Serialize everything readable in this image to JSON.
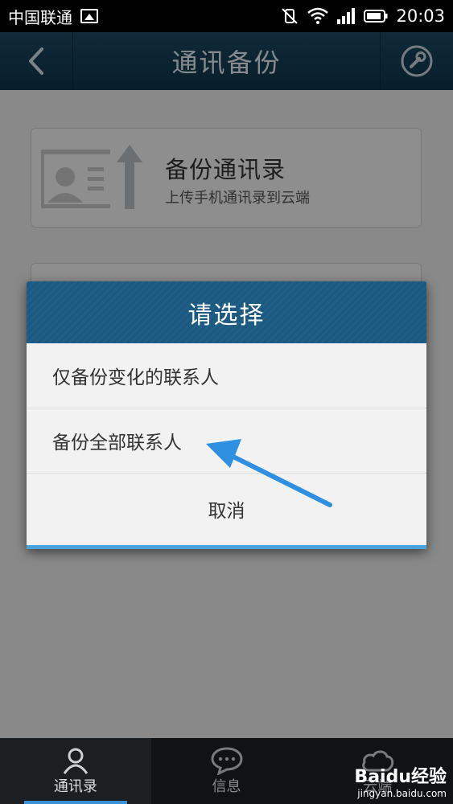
{
  "statusbar": {
    "carrier": "中国联通",
    "time": "20:03"
  },
  "header": {
    "title": "通讯备份"
  },
  "cards": [
    {
      "title": "备份通讯录",
      "subtitle": "上传手机通讯录到云端"
    }
  ],
  "dialog": {
    "title": "请选择",
    "options": [
      "仅备份变化的联系人",
      "备份全部联系人"
    ],
    "cancel": "取消"
  },
  "bottomnav": {
    "items": [
      {
        "label": "通讯录",
        "icon": "person-icon",
        "active": true
      },
      {
        "label": "信息",
        "icon": "chat-bubble-icon",
        "active": false
      },
      {
        "label": "云端",
        "icon": "cloud-icon",
        "active": false
      }
    ]
  },
  "watermark": {
    "line1": "Baidu经验",
    "line2": "jingyan.baidu.com"
  },
  "colors": {
    "header": "#1d4a63",
    "dialog_header": "#1f5e86",
    "accent": "#3a93d6",
    "arrow": "#2f8fe0"
  }
}
